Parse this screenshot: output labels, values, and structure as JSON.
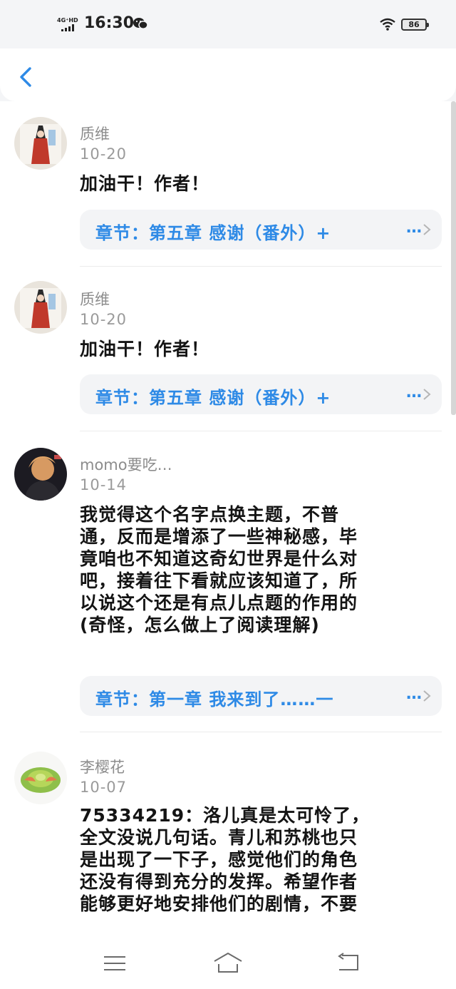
{
  "status_bar": {
    "network": "4G⁺HD",
    "time": "16:30",
    "battery": "86"
  },
  "comments": [
    {
      "username": "质维",
      "date": "10-20",
      "lines": [
        "加油干！作者！"
      ],
      "chapter": "章节：第五章 感谢（番外）+"
    },
    {
      "username": "质维",
      "date": "10-20",
      "lines": [
        "加油干！作者！"
      ],
      "chapter": "章节：第五章 感谢（番外）+"
    },
    {
      "username": "momo要吃…",
      "date": "10-14",
      "lines": [
        "我觉得这个名字点换主题，不普",
        "通，反而是增添了一些神秘感，毕",
        "竟咱也不知道这奇幻世界是什么对",
        "吧，接着往下看就应该知道了，所",
        "以说这个还是有点儿点题的作用的",
        "(奇怪，怎么做上了阅读理解)"
      ],
      "chapter": "章节：第一章 我来到了……一"
    },
    {
      "username": "李樱花",
      "date": "10-07",
      "lines": [
        "75334219：洛儿真是太可怜了，",
        "全文没说几句话。青儿和苏桃也只",
        "是出现了一下子，感觉他们的角色",
        "还没有得到充分的发挥。希望作者",
        "能够更好地安排他们的剧情，不要"
      ]
    }
  ],
  "ellipsis": "…",
  "icons": {
    "back": "chevron-left-icon",
    "chapter_arrow": "chevron-right-icon",
    "menu": "menu-icon",
    "home": "home-icon",
    "return": "return-icon"
  },
  "colors": {
    "accent": "#2e8ae6",
    "chapter_bg": "#f3f4f6",
    "meta_text": "#8c8c8c"
  }
}
